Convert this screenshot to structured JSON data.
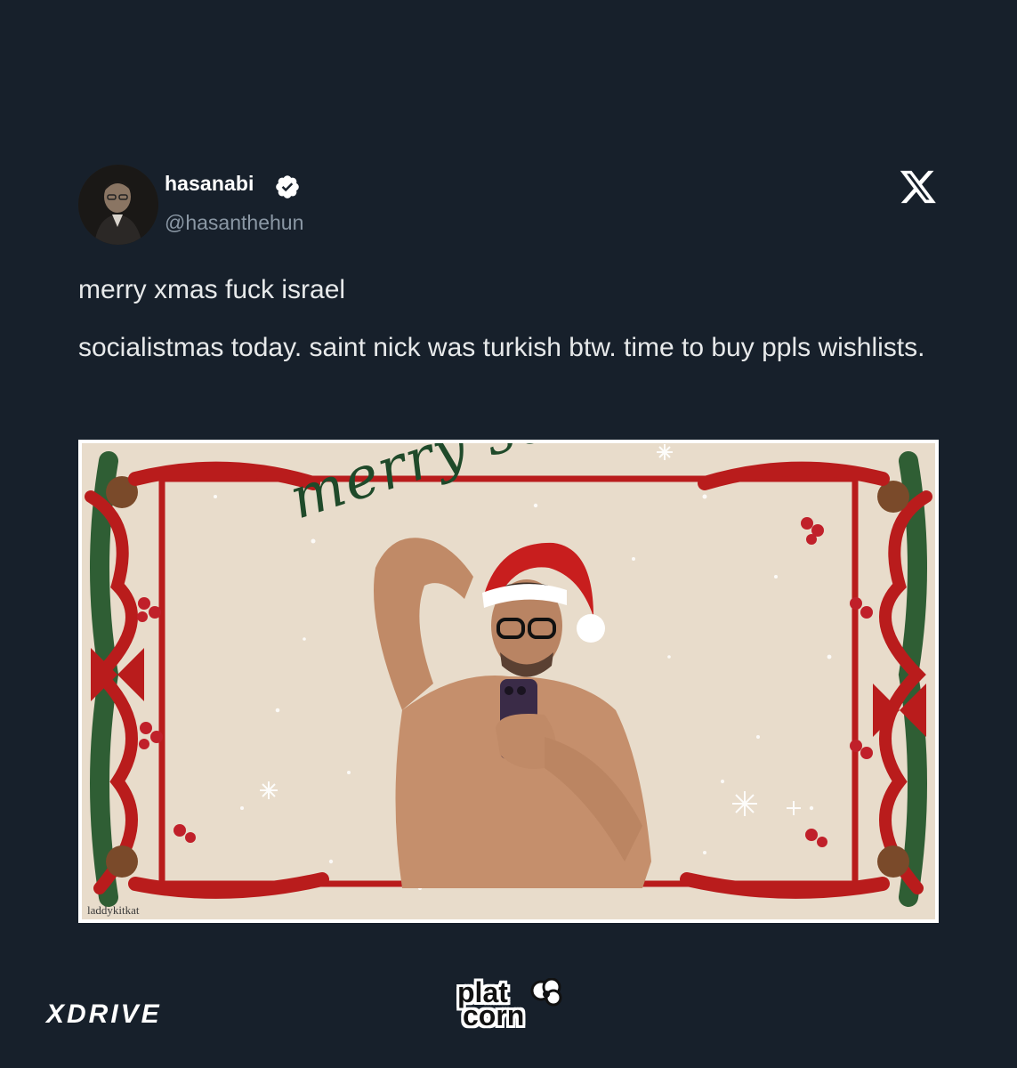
{
  "tweet": {
    "display_name": "hasanabi",
    "handle": "@hasanthehun",
    "verified": true,
    "text_line_1": "merry xmas fuck israel",
    "text_line_2": "socialistmas today. saint nick was turkish btw. time to buy ppls wishlists.",
    "platform_icon": "x-logo-icon"
  },
  "media": {
    "card_text": "merry socialistmas",
    "watermark": "laddykitkat",
    "colors": {
      "background": "#e8dccb",
      "ribbon": "#b91c1c",
      "pine": "#2f5e34",
      "script": "#1f4a2a"
    }
  },
  "footer": {
    "left_brand": "XDRIVE",
    "center_brand_top": "plat",
    "center_brand_bottom": "corn"
  },
  "colors": {
    "page_background": "#17202b",
    "verified_badge": "#ffffff",
    "handle_text": "#8b98a5",
    "brand_accent": "#e0201e"
  }
}
